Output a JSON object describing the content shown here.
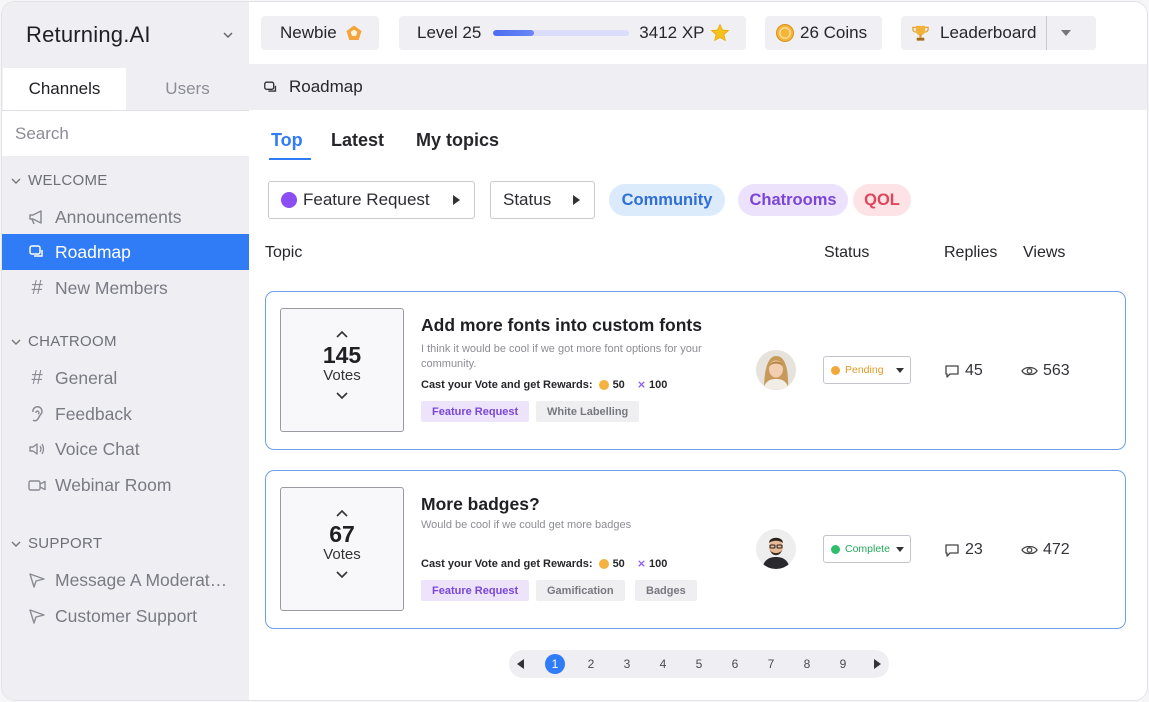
{
  "app": {
    "brand": "Returning.AI"
  },
  "sidebar": {
    "tabs": [
      "Channels",
      "Users"
    ],
    "search_placeholder": "Search",
    "sections": [
      {
        "title": "WELCOME",
        "items": [
          {
            "label": "Announcements",
            "icon": "megaphone-icon"
          },
          {
            "label": "Roadmap",
            "icon": "roadmap-icon",
            "active": true
          },
          {
            "label": "New Members",
            "icon": "hash-icon"
          }
        ]
      },
      {
        "title": "CHATROOM",
        "items": [
          {
            "label": "General",
            "icon": "hash-icon"
          },
          {
            "label": "Feedback",
            "icon": "ear-icon"
          },
          {
            "label": "Voice Chat",
            "icon": "speaker-icon"
          },
          {
            "label": "Webinar Room",
            "icon": "video-icon"
          }
        ]
      },
      {
        "title": "SUPPORT",
        "items": [
          {
            "label": "Message A Moderat…",
            "icon": "send-icon"
          },
          {
            "label": "Customer Support",
            "icon": "send-icon"
          }
        ]
      }
    ]
  },
  "topbar": {
    "rank": "Newbie",
    "level": "Level 25",
    "xp": "3412 XP",
    "xp_progress": 0.3,
    "coins": "26 Coins",
    "leaderboard": "Leaderboard"
  },
  "header": {
    "title": "Roadmap"
  },
  "main": {
    "tabs": [
      "Top",
      "Latest",
      "My topics"
    ],
    "filters": [
      "Feature Request",
      "Status"
    ],
    "chips": [
      {
        "label": "Community",
        "bg": "#dcebfb",
        "fg": "#2f6fd6"
      },
      {
        "label": "Chatrooms",
        "bg": "#ece2fb",
        "fg": "#7b45d8"
      },
      {
        "label": "QOL",
        "bg": "#fde3e6",
        "fg": "#e0455b"
      }
    ],
    "columns": {
      "topic": "Topic",
      "status": "Status",
      "replies": "Replies",
      "views": "Views"
    },
    "topics": [
      {
        "votes": "145",
        "votes_label": "Votes",
        "title": "Add more fonts into custom fonts",
        "description": "I think it would be cool if we got more font options for your community.",
        "reward_label": "Cast your Vote and get Rewards:",
        "reward_coins": "50",
        "reward_xp": "100",
        "tags": [
          "Feature Request",
          "White Labelling"
        ],
        "status": "Pending",
        "status_color": "#f2a93b",
        "status_text_color": "#e39a24",
        "replies": "45",
        "views": "563"
      },
      {
        "votes": "67",
        "votes_label": "Votes",
        "title": "More badges?",
        "description": "Would be cool if we could get more badges",
        "reward_label": "Cast your Vote and get Rewards:",
        "reward_coins": "50",
        "reward_xp": "100",
        "tags": [
          "Feature Request",
          "Gamification",
          "Badges"
        ],
        "status": "Complete",
        "status_color": "#2fbf6b",
        "status_text_color": "#23a85a",
        "replies": "23",
        "views": "472"
      }
    ],
    "pagination": {
      "current": "1",
      "pages": [
        "1",
        "2",
        "3",
        "4",
        "5",
        "6",
        "7",
        "8",
        "9"
      ]
    }
  }
}
